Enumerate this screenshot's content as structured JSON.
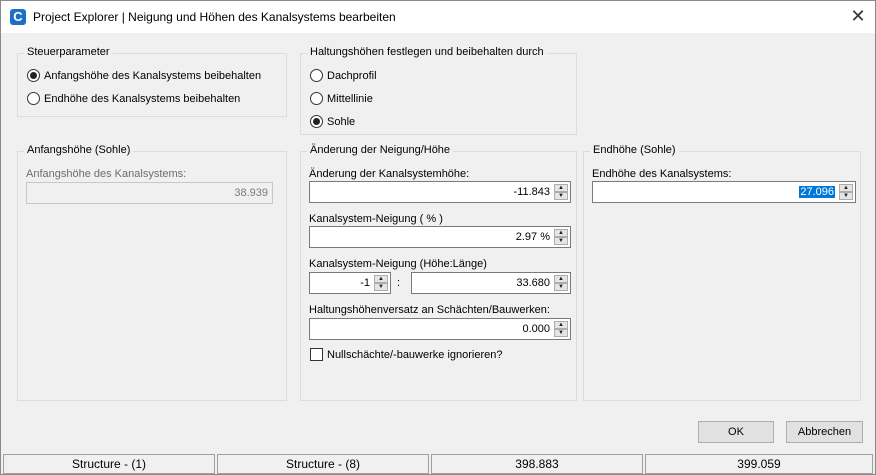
{
  "window": {
    "title": "Project Explorer | Neigung und Höhen des Kanalsystems bearbeiten",
    "app_icon_letter": "C",
    "close_glyph": "✕"
  },
  "steuerparameter": {
    "legend": "Steuerparameter",
    "options": [
      {
        "label": "Anfangshöhe des Kanalsystems beibehalten",
        "checked": true
      },
      {
        "label": "Endhöhe des Kanalsystems beibehalten",
        "checked": false
      }
    ]
  },
  "haltungshoehen": {
    "legend": "Haltungshöhen festlegen und beibehalten durch",
    "options": [
      {
        "label": "Dachprofil",
        "checked": false
      },
      {
        "label": "Mittellinie",
        "checked": false
      },
      {
        "label": "Sohle",
        "checked": true
      }
    ]
  },
  "anfangshoehe": {
    "legend": "Anfangshöhe (Sohle)",
    "field_label": "Anfangshöhe des Kanalsystems:",
    "value": "38.939"
  },
  "neigung": {
    "legend": "Änderung der Neigung/Höhe",
    "aenderung_label": "Änderung der Kanalsystemhöhe:",
    "aenderung_value": "-11.843",
    "prozent_label": "Kanalsystem-Neigung ( % )",
    "prozent_value": "2.97 %",
    "verhaeltnis_label": "Kanalsystem-Neigung (Höhe:Länge)",
    "verhaeltnis_hoehe": "-1",
    "separator": ":",
    "verhaeltnis_laenge": "33.680",
    "versatz_label": "Haltungshöhenversatz an Schächten/Bauwerken:",
    "versatz_value": "0.000",
    "null_checkbox_label": "Nullschächte/-bauwerke ignorieren?"
  },
  "endhoehe": {
    "legend": "Endhöhe (Sohle)",
    "field_label": "Endhöhe des Kanalsystems:",
    "value": "27.096"
  },
  "buttons": {
    "ok": "OK",
    "cancel": "Abbrechen"
  },
  "statusbar": [
    "Structure - (1)",
    "Structure - (8)",
    "398.883",
    "399.059"
  ]
}
